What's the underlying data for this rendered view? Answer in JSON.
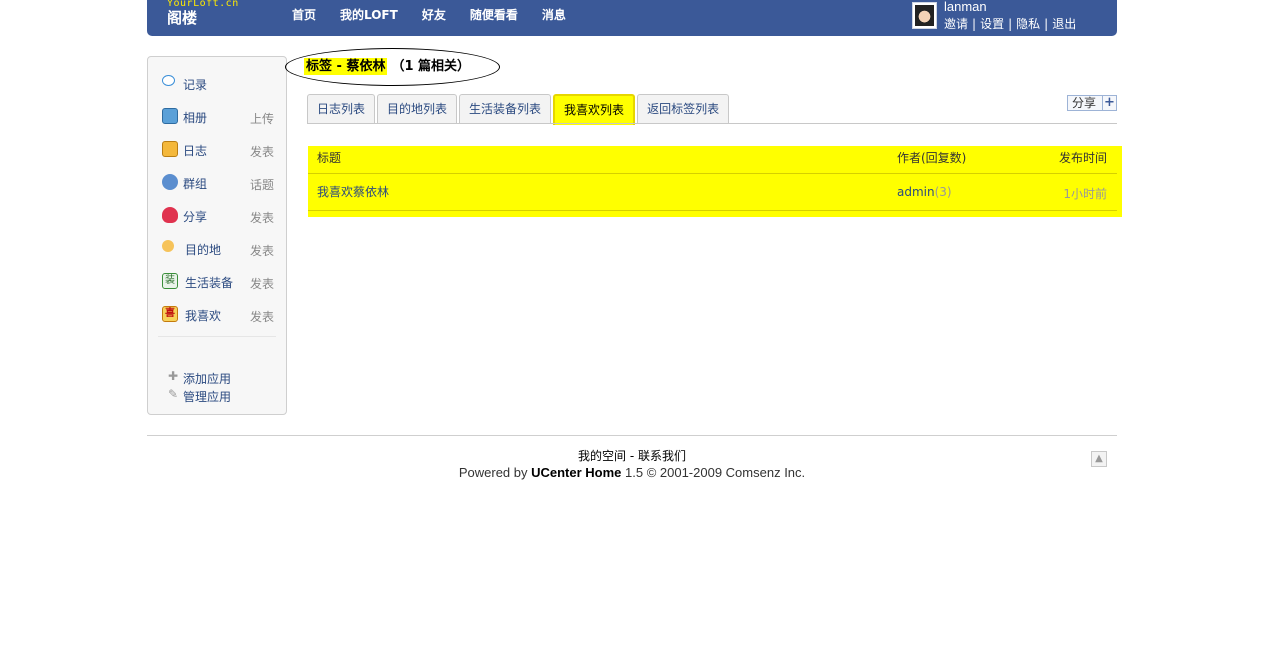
{
  "header": {
    "logo_small": "YourLoft.cn",
    "logo_big": "阁楼",
    "nav": [
      "首页",
      "我的LOFT",
      "好友",
      "随便看看",
      "消息"
    ],
    "username": "lanman",
    "usermenu": [
      "邀请",
      "设置",
      "隐私",
      "退出"
    ]
  },
  "sidebar": {
    "items": [
      {
        "name": "记录",
        "action": ""
      },
      {
        "name": "相册",
        "action": "上传"
      },
      {
        "name": "日志",
        "action": "发表"
      },
      {
        "name": "群组",
        "action": "话题"
      },
      {
        "name": "分享",
        "action": "发表"
      },
      {
        "name": "目的地",
        "action": "发表"
      },
      {
        "name": "生活装备",
        "action": "发表"
      },
      {
        "name": "我喜欢",
        "action": "发表"
      }
    ],
    "like_icon_char": "喜",
    "gear_icon_char": "装",
    "add_app": "添加应用",
    "manage_app": "管理应用"
  },
  "title": {
    "tag_label": "标签 - 蔡依林",
    "count": "（1 篇相关）"
  },
  "tabs": [
    "日志列表",
    "目的地列表",
    "生活装备列表",
    "我喜欢列表",
    "返回标签列表"
  ],
  "share_label": "分享",
  "table": {
    "headers": [
      "标题",
      "作者(回复数)",
      "发布时间"
    ],
    "rows": [
      {
        "title": "我喜欢蔡依林",
        "author": "admin",
        "replies": "(3)",
        "time": "1小时前"
      }
    ]
  },
  "footer": {
    "link1": "我的空间",
    "link2": "联系我们",
    "powered_prefix": "Powered by ",
    "powered_brand": "UCenter Home",
    "powered_suffix": " 1.5 © 2001-2009 Comsenz Inc."
  }
}
